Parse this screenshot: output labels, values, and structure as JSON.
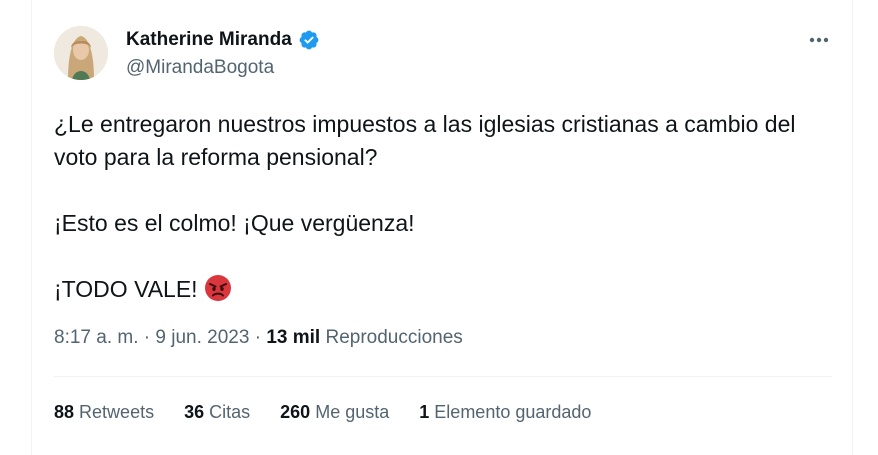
{
  "author": {
    "name": "Katherine Miranda",
    "handle": "@MirandaBogota",
    "verified_color": "#1d9bf0",
    "verified_icon": "verified-badge-icon"
  },
  "tweet": {
    "paragraphs": [
      "¿Le entregaron nuestros impuestos a las iglesias cristianas a cambio del voto para la reforma pensional?",
      "¡Esto es el colmo! ¡Que vergüenza!",
      "¡TODO VALE!"
    ],
    "emoji": "angry-face-emoji"
  },
  "meta": {
    "time": "8:17 a. m.",
    "date": "9 jun. 2023",
    "views_count": "13 mil",
    "views_label": "Reproducciones"
  },
  "stats": {
    "retweets_count": "88",
    "retweets_label": "Retweets",
    "quotes_count": "36",
    "quotes_label": "Citas",
    "likes_count": "260",
    "likes_label": "Me gusta",
    "bookmarks_count": "1",
    "bookmarks_label": "Elemento guardado"
  }
}
